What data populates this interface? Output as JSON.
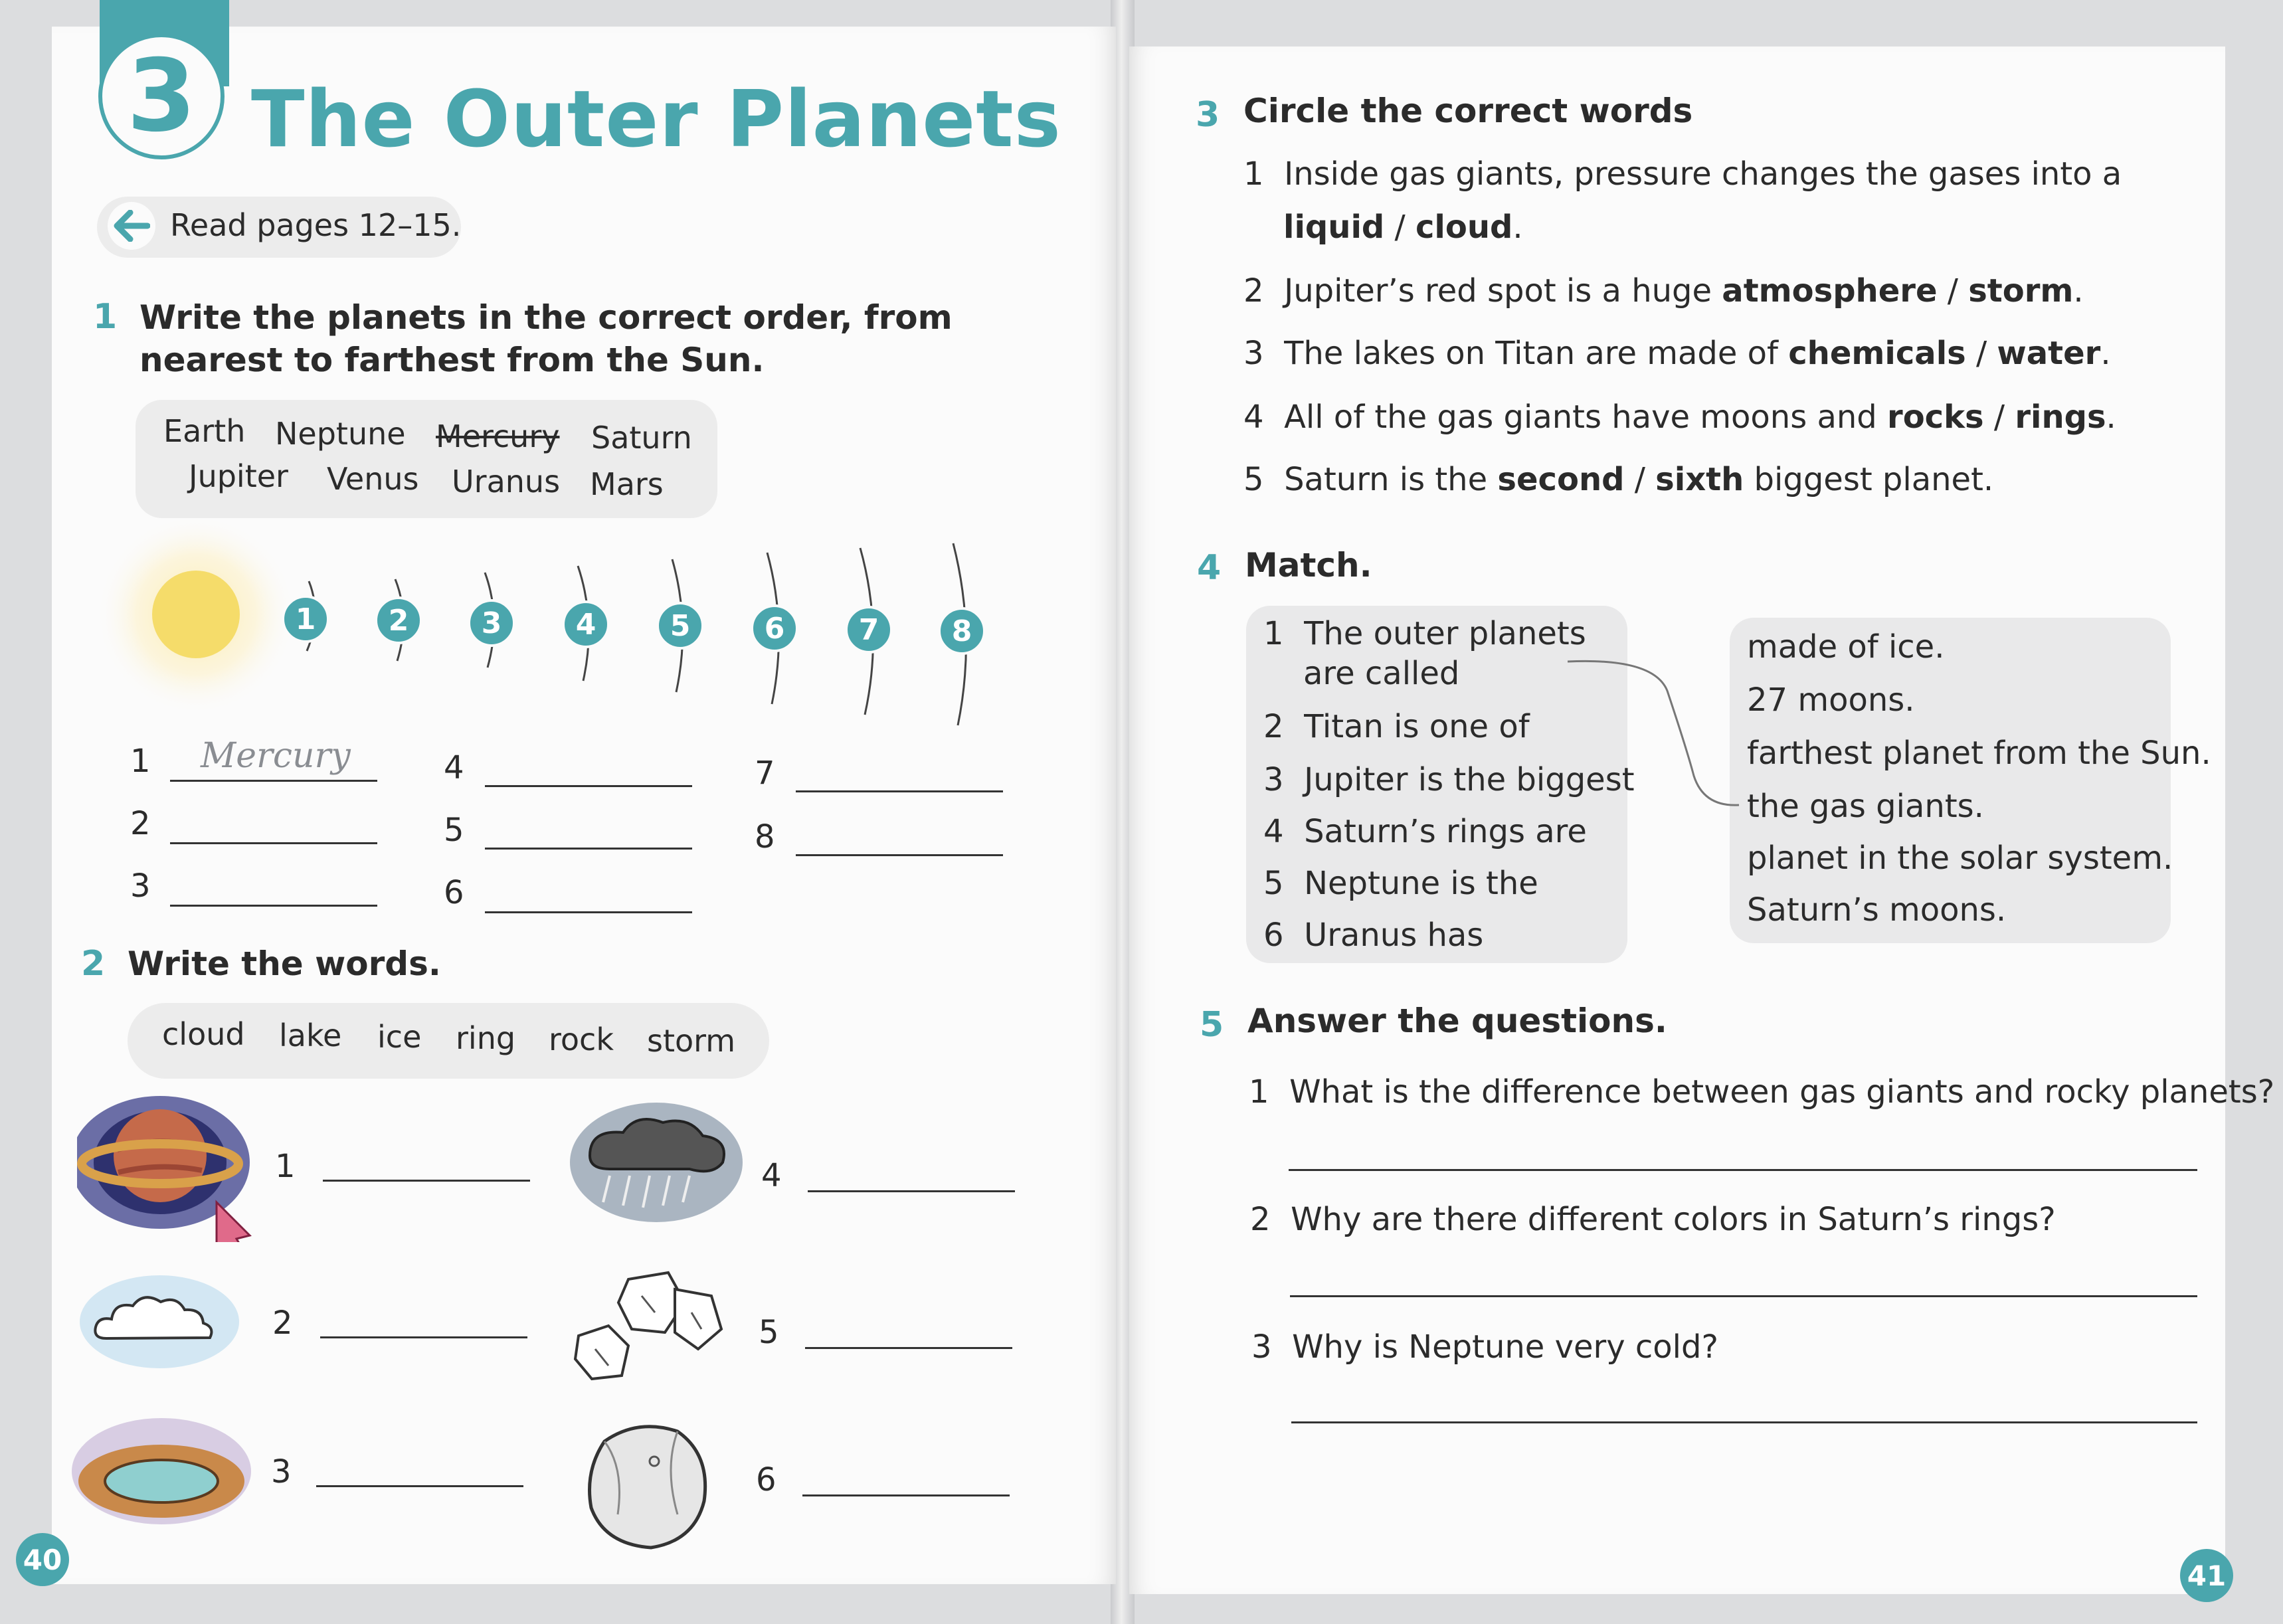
{
  "unit": {
    "number": "3",
    "title": "The Outer Planets",
    "read_pages": "Read pages 12–15."
  },
  "ex1": {
    "number": "1",
    "instruction": "Write the planets in the correct order, from nearest to farthest from the Sun.",
    "words_row1": [
      "Earth",
      "Neptune",
      "Mercury",
      "Saturn"
    ],
    "words_row2": [
      "Jupiter",
      "Venus",
      "Uranus",
      "Mars"
    ],
    "orbit_numbers": [
      "1",
      "2",
      "3",
      "4",
      "5",
      "6",
      "7",
      "8"
    ],
    "answer_numbers": [
      "1",
      "2",
      "3",
      "4",
      "5",
      "6",
      "7",
      "8"
    ],
    "sample_answer": "Mercury"
  },
  "ex2": {
    "number": "2",
    "instruction": "Write the words.",
    "words": [
      "cloud",
      "lake",
      "ice",
      "ring",
      "rock",
      "storm"
    ],
    "item_numbers": [
      "1",
      "2",
      "3",
      "4",
      "5",
      "6"
    ]
  },
  "ex3": {
    "number": "3",
    "instruction": "Circle the correct words",
    "items": [
      {
        "n": "1",
        "pre": "Inside gas giants, pressure changes the gases into a",
        "a": "liquid",
        "sep": " / ",
        "b": "cloud",
        "post": "."
      },
      {
        "n": "2",
        "pre": "Jupiter’s red spot is a huge ",
        "a": "atmosphere",
        "sep": " / ",
        "b": "storm",
        "post": "."
      },
      {
        "n": "3",
        "pre": "The lakes on Titan are made of ",
        "a": "chemicals",
        "sep": " / ",
        "b": "water",
        "post": "."
      },
      {
        "n": "4",
        "pre": "All of the gas giants have moons and ",
        "a": "rocks",
        "sep": " / ",
        "b": "rings",
        "post": "."
      },
      {
        "n": "5",
        "pre": "Saturn is the ",
        "a": "second",
        "sep": " / ",
        "b": "sixth",
        "post": " biggest planet."
      }
    ]
  },
  "ex4": {
    "number": "4",
    "instruction": "Match.",
    "left": [
      {
        "n": "1",
        "text": "The outer planets",
        "text2": "are called"
      },
      {
        "n": "2",
        "text": "Titan is one of"
      },
      {
        "n": "3",
        "text": "Jupiter is the biggest"
      },
      {
        "n": "4",
        "text": "Saturn’s rings are"
      },
      {
        "n": "5",
        "text": "Neptune is the"
      },
      {
        "n": "6",
        "text": "Uranus has"
      }
    ],
    "right": [
      "made of ice.",
      "27 moons.",
      "farthest planet from the Sun.",
      "the gas giants.",
      "planet in the solar system.",
      "Saturn’s moons."
    ]
  },
  "ex5": {
    "number": "5",
    "instruction": "Answer the questions.",
    "questions": [
      {
        "n": "1",
        "text": "What is the difference between gas giants and rocky planets?"
      },
      {
        "n": "2",
        "text": "Why are there different colors in Saturn’s rings?"
      },
      {
        "n": "3",
        "text": "Why is Neptune very cold?"
      }
    ]
  },
  "page_numbers": {
    "left": "40",
    "right": "41"
  },
  "colors": {
    "accent": "#4aa6ad",
    "box": "#ececec",
    "sun": "#f5dc6a"
  }
}
